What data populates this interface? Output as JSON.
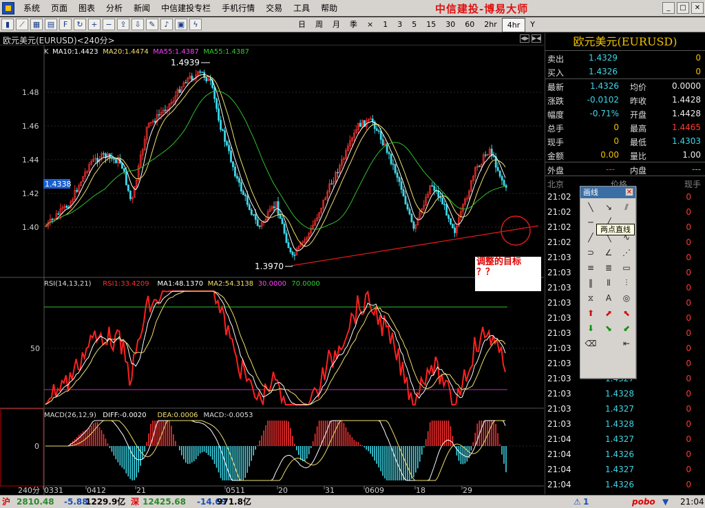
{
  "menubar": {
    "items": [
      "系统",
      "页面",
      "图表",
      "分析",
      "新闻",
      "中信建投专栏",
      "手机行情",
      "交易",
      "工具",
      "帮助"
    ],
    "brand": "中信建投-博易大师",
    "window_buttons": [
      "minimize-icon",
      "restore-icon",
      "close-icon"
    ]
  },
  "toolbar": {
    "icons": [
      "candles-icon",
      "line-chart-icon",
      "grid-icon",
      "table-icon",
      "f10-icon",
      "refresh-icon",
      "zoom-in-icon",
      "zoom-out-icon",
      "export-icon",
      "import-icon",
      "draw-line-icon",
      "alarm-icon",
      "tools-icon",
      "flash-icon"
    ],
    "periods": [
      "日",
      "周",
      "月",
      "季",
      "×",
      "1",
      "3",
      "5",
      "15",
      "30",
      "60",
      "2hr",
      "4hr",
      "Y"
    ],
    "active_period": "4hr"
  },
  "chart": {
    "header": "欧元美元(EURUSD)<240分>",
    "price_panel": {
      "indicators": [
        {
          "text": "K",
          "color": "#dddddd"
        },
        {
          "text": "MA10:1.4423",
          "color": "#ffffff"
        },
        {
          "text": "MA20:1.4474",
          "color": "#f2e070"
        },
        {
          "text": "MA55:1.4387",
          "color": "#ff40ff"
        },
        {
          "text": "MA55:1.4387",
          "color": "#30d030"
        }
      ],
      "high_label": "1.4939",
      "low_label": "1.3970",
      "current_price_tag": "1.4338",
      "y_ticks": [
        "1.48",
        "1.46",
        "1.44",
        "1.42",
        "1.40"
      ]
    },
    "rsi_panel": {
      "indicators": [
        {
          "text": "RSI(14,13,21)",
          "color": "#dddddd"
        },
        {
          "text": "RSI1:33.4209",
          "color": "#ff3030"
        },
        {
          "text": "MA1:48.1370",
          "color": "#ffffff"
        },
        {
          "text": "MA2:54.3138",
          "color": "#f2e070"
        },
        {
          "text": "30.0000",
          "color": "#ff40ff"
        },
        {
          "text": "70.0000",
          "color": "#30d030"
        }
      ],
      "y_ticks": [
        "50"
      ]
    },
    "macd_panel": {
      "indicators": [
        {
          "text": "MACD(26,12,9)",
          "color": "#dddddd"
        },
        {
          "text": "DIFF:-0.0020",
          "color": "#ffffff"
        },
        {
          "text": "DEA:0.0006",
          "color": "#f2e070"
        },
        {
          "text": "MACD:-0.0053",
          "color": "#dddddd"
        }
      ],
      "y_ticks": [
        "0"
      ]
    },
    "x_axis": {
      "period_label": "240分",
      "ticks": [
        "0331",
        "0412",
        "21",
        "0511",
        "20",
        "31",
        "0609",
        "18",
        "29"
      ]
    },
    "annotation": {
      "line1": "调整的目标",
      "line2": "？？"
    },
    "colors": {
      "up": "#ff3030",
      "down": "#3ed7e8",
      "ma_white": "#ffffff",
      "ma_yellow": "#f2e070",
      "ma_green": "#30c030",
      "trendline": "#e01818",
      "rsi_red": "#ff2020"
    }
  },
  "quote": {
    "title": "欧元美元(EURUSD)",
    "rows1": [
      {
        "label": "卖出",
        "value": "1.4329",
        "value_class": "cy",
        "qty": "0",
        "qty_class": "yel"
      },
      {
        "label": "买入",
        "value": "1.4326",
        "value_class": "cy",
        "qty": "0",
        "qty_class": "yel"
      }
    ],
    "rows2": [
      {
        "l1": "最新",
        "v1": "1.4326",
        "c1": "cy",
        "l2": "均价",
        "v2": "0.0000",
        "c2": "wht"
      },
      {
        "l1": "涨跌",
        "v1": "-0.0102",
        "c1": "cy",
        "l2": "昨收",
        "v2": "1.4428",
        "c2": "wht"
      },
      {
        "l1": "幅度",
        "v1": "-0.71%",
        "c1": "cy",
        "l2": "开盘",
        "v2": "1.4428",
        "c2": "wht"
      },
      {
        "l1": "总手",
        "v1": "0",
        "c1": "yel",
        "l2": "最高",
        "v2": "1.4465",
        "c2": "red"
      },
      {
        "l1": "现手",
        "v1": "0",
        "c1": "yel",
        "l2": "最低",
        "v2": "1.4303",
        "c2": "cy"
      },
      {
        "l1": "金额",
        "v1": "0.00",
        "c1": "yel",
        "l2": "量比",
        "v2": "1.00",
        "c2": "wht"
      }
    ],
    "outer_label": "外盘",
    "outer_value": "---",
    "inner_label": "内盘",
    "inner_value": "---",
    "ticks_header": {
      "time": "北京",
      "price": "价格",
      "qty": "现手"
    },
    "ticks": [
      {
        "time": "21:02",
        "price": "",
        "qty": "0"
      },
      {
        "time": "21:02",
        "price": "",
        "qty": "0"
      },
      {
        "time": "21:02",
        "price": "",
        "qty": "0"
      },
      {
        "time": "21:02",
        "price": "",
        "qty": "0"
      },
      {
        "time": "21:03",
        "price": "",
        "qty": "0"
      },
      {
        "time": "21:03",
        "price": "",
        "qty": "0"
      },
      {
        "time": "21:03",
        "price": "",
        "qty": "0"
      },
      {
        "time": "21:03",
        "price": "",
        "qty": "0"
      },
      {
        "time": "21:03",
        "price": "",
        "qty": "0"
      },
      {
        "time": "21:03",
        "price": "",
        "qty": "0"
      },
      {
        "time": "21:03",
        "price": "",
        "qty": "0"
      },
      {
        "time": "21:03",
        "price": "",
        "qty": "0"
      },
      {
        "time": "21:03",
        "price": "1.4327",
        "qty": "0"
      },
      {
        "time": "21:03",
        "price": "1.4328",
        "qty": "0"
      },
      {
        "time": "21:03",
        "price": "1.4327",
        "qty": "0"
      },
      {
        "time": "21:03",
        "price": "1.4328",
        "qty": "0"
      },
      {
        "time": "21:04",
        "price": "1.4327",
        "qty": "0"
      },
      {
        "time": "21:04",
        "price": "1.4326",
        "qty": "0"
      },
      {
        "time": "21:04",
        "price": "1.4327",
        "qty": "0"
      },
      {
        "time": "21:04",
        "price": "1.4326",
        "qty": "0"
      }
    ]
  },
  "palette": {
    "title": "画线",
    "tooltip": "两点直线",
    "tools": [
      "line-segment-icon",
      "ray-icon",
      "parallel-lines-icon",
      "horizontal-line-icon",
      "two-point-line-icon",
      "blank",
      "up-line-icon",
      "down-line-icon",
      "wave-icon",
      "arc-icon",
      "angle-icon",
      "fan-icon",
      "channel-icon",
      "regression-channel-icon",
      "box-icon",
      "vertical-lines-icon",
      "fibonacci-time-icon",
      "gann-icon",
      "cycle-icon",
      "text-tool-icon",
      "gann-circle-icon",
      "arrow-up-icon",
      "arrow-up-right-icon",
      "arrow-up-left-icon",
      "arrow-down-icon",
      "arrow-down-right-icon",
      "arrow-down-left-icon",
      "eraser-icon",
      "blank",
      "delete-all-icon"
    ],
    "text_tool_label": "A"
  },
  "statusbar": {
    "sh_label": "沪",
    "sh_index": "2810.48",
    "sh_change": "-5.88",
    "sh_amount": "1229.9亿",
    "sz_label": "深",
    "sz_index": "12425.68",
    "sz_change": "-14.69",
    "sz_amount": "971.8亿",
    "alert": "1",
    "brand": "pobo",
    "time": "21:04"
  }
}
